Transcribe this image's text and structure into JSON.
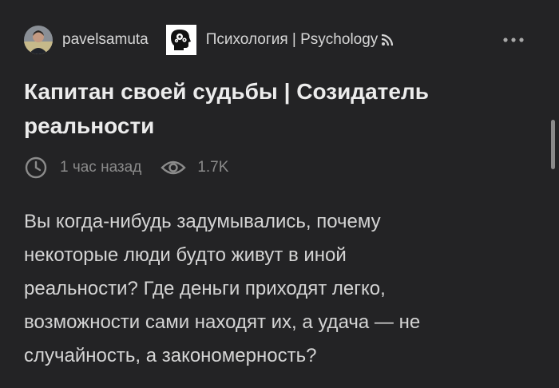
{
  "post": {
    "author": "pavelsamuta",
    "community": "Психология | Psychology",
    "title": "Капитан своей судьбы | Созидатель реальности",
    "time_ago": "1 час назад",
    "views": "1.7K",
    "body_lines": [
      "Вы когда-нибудь задумывались, почему",
      "некоторые люди будто живут в иной",
      "реальности? Где деньги приходят легко,",
      "возможности сами находят их, а удача — не",
      "случайность, а закономерность?"
    ]
  },
  "icons": {
    "avatar": "author-avatar",
    "community": "head-with-gears-icon",
    "rss": "rss-icon",
    "more": "more-dots-icon",
    "clock": "clock-icon",
    "views": "eye-icon"
  },
  "colors": {
    "background": "#232325",
    "text": "#e6e6e6",
    "muted": "#8b8b8b"
  }
}
